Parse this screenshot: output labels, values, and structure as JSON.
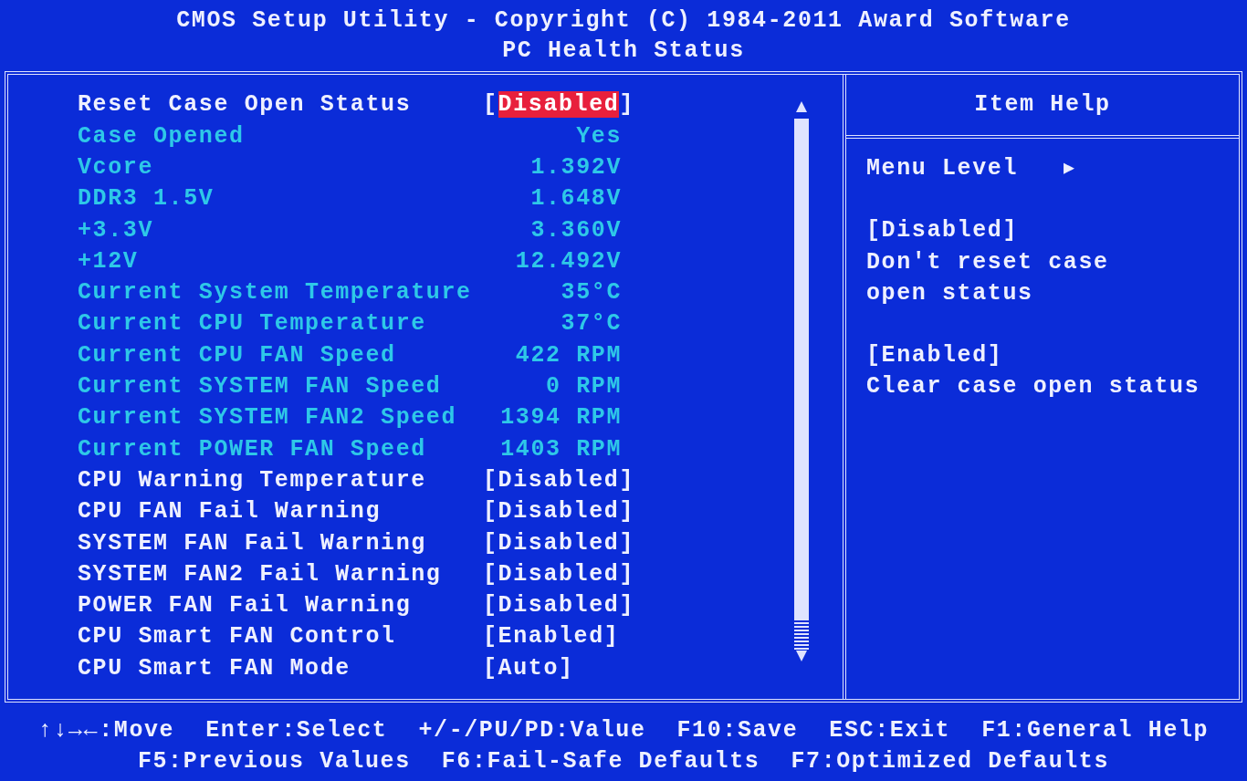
{
  "header": {
    "title": "CMOS Setup Utility - Copyright (C) 1984-2011 Award Software",
    "subtitle": "PC Health Status"
  },
  "items": [
    {
      "kind": "setting",
      "label": "Reset Case Open Status",
      "open": "[",
      "value": "Disabled",
      "close": "]",
      "selected": true
    },
    {
      "kind": "reading",
      "label": "Case Opened",
      "value": "Yes"
    },
    {
      "kind": "reading",
      "label": "Vcore",
      "value": "1.392V"
    },
    {
      "kind": "reading",
      "label": "DDR3 1.5V",
      "value": "1.648V"
    },
    {
      "kind": "reading",
      "label": "+3.3V",
      "value": "3.360V"
    },
    {
      "kind": "reading",
      "label": "+12V",
      "value": "12.492V"
    },
    {
      "kind": "reading",
      "label": "Current System Temperature",
      "value": "35°C"
    },
    {
      "kind": "reading",
      "label": "Current CPU Temperature",
      "value": "37°C"
    },
    {
      "kind": "reading",
      "label": "Current CPU FAN Speed",
      "value": "422 RPM"
    },
    {
      "kind": "reading",
      "label": "Current SYSTEM FAN Speed",
      "value": "0 RPM"
    },
    {
      "kind": "reading",
      "label": "Current SYSTEM FAN2 Speed",
      "value": "1394 RPM"
    },
    {
      "kind": "reading",
      "label": "Current POWER FAN Speed",
      "value": "1403 RPM"
    },
    {
      "kind": "setting",
      "label": "CPU Warning Temperature",
      "open": "[",
      "value": "Disabled",
      "close": "]",
      "selected": false
    },
    {
      "kind": "setting",
      "label": "CPU FAN Fail Warning",
      "open": "[",
      "value": "Disabled",
      "close": "]",
      "selected": false
    },
    {
      "kind": "setting",
      "label": "SYSTEM FAN Fail Warning",
      "open": "[",
      "value": "Disabled",
      "close": "]",
      "selected": false
    },
    {
      "kind": "setting",
      "label": "SYSTEM FAN2 Fail Warning",
      "open": "[",
      "value": "Disabled",
      "close": "]",
      "selected": false
    },
    {
      "kind": "setting",
      "label": "POWER FAN Fail Warning",
      "open": "[",
      "value": "Disabled",
      "close": "]",
      "selected": false
    },
    {
      "kind": "setting",
      "label": "CPU Smart FAN Control",
      "open": "[",
      "value": "Enabled",
      "close": "]",
      "selected": false
    },
    {
      "kind": "setting",
      "label": "CPU Smart FAN Mode",
      "open": "[",
      "value": "Auto",
      "close": "]",
      "selected": false
    }
  ],
  "help": {
    "title": "Item Help",
    "menu_level": "Menu Level",
    "menu_level_arrow": "▶",
    "blocks": [
      {
        "heading": "[Disabled]",
        "lines": [
          "Don't reset case",
          "open status"
        ]
      },
      {
        "heading": "[Enabled]",
        "lines": [
          "Clear case open status"
        ]
      }
    ]
  },
  "footer": [
    [
      "↑↓→←:Move",
      "Enter:Select",
      "+/-/PU/PD:Value",
      "F10:Save",
      "ESC:Exit",
      "F1:General Help"
    ],
    [
      "F5:Previous Values",
      "F6:Fail-Safe Defaults",
      "F7:Optimized Defaults"
    ]
  ]
}
